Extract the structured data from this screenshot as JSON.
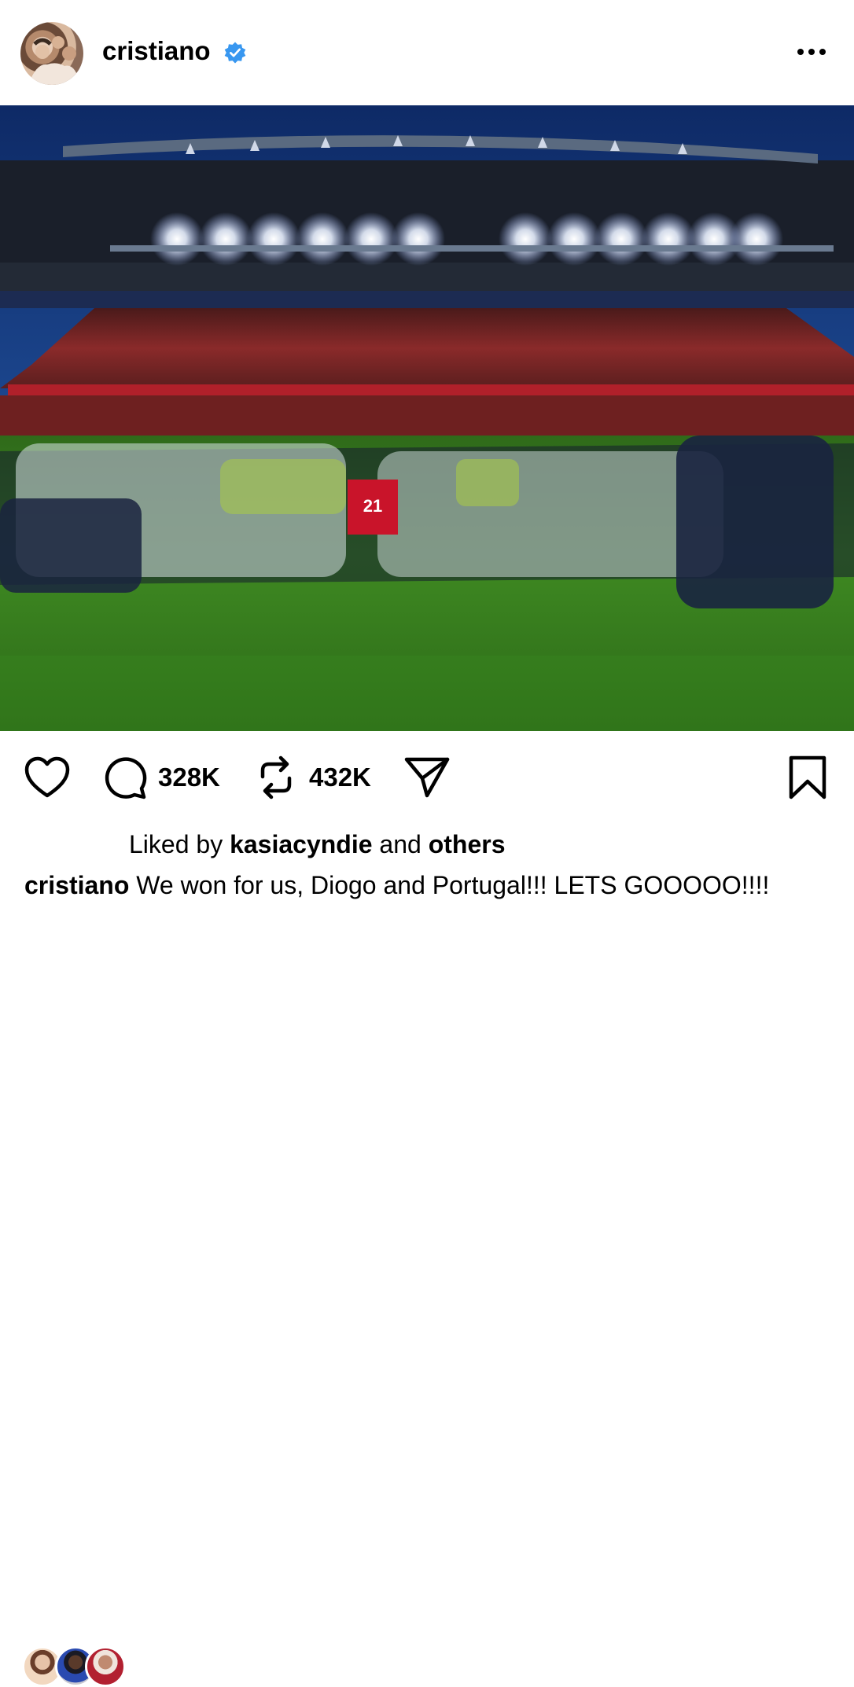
{
  "post": {
    "username": "cristiano",
    "verified": true,
    "more_icon": "more-horizontal-icon",
    "photo_alt": "",
    "jersey_number": "21"
  },
  "actions": {
    "like_icon": "heart-icon",
    "comment_icon": "comment-icon",
    "comment_count": "328K",
    "repost_icon": "repost-icon",
    "repost_count": "432K",
    "share_icon": "send-icon",
    "save_icon": "bookmark-icon"
  },
  "likes": {
    "prefix": "Liked by",
    "user": "kasiacyndie",
    "middle": "and",
    "suffix": "others"
  },
  "caption": {
    "username": "cristiano",
    "text": "We won for us, Diogo and Portugal!!! LETS GOOOOO!!!!"
  },
  "colors": {
    "verified_blue": "#3897f0",
    "text": "#000000",
    "background": "#ffffff"
  }
}
